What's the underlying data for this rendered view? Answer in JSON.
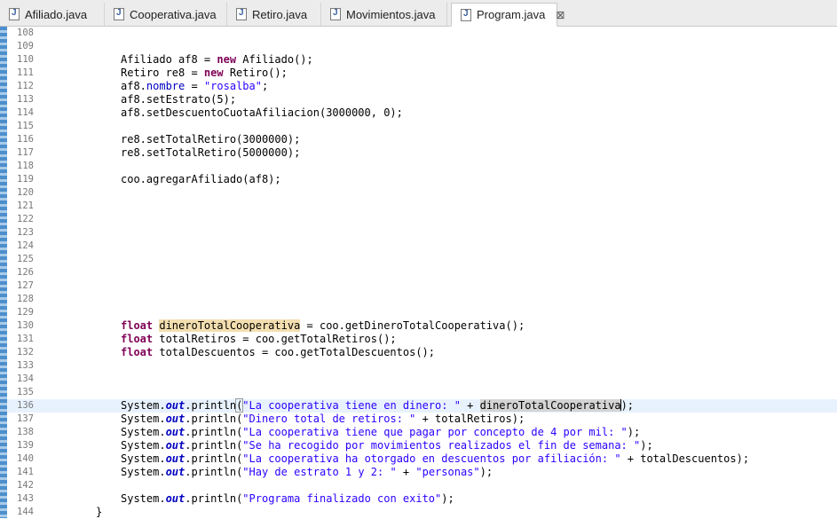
{
  "tabs": [
    {
      "label": "Afiliado.java"
    },
    {
      "label": "Cooperativa.java"
    },
    {
      "label": "Retiro.java"
    },
    {
      "label": "Movimientos.java"
    },
    {
      "label": "Program.java",
      "close": "⊠"
    }
  ],
  "lines": [
    {
      "n": "108",
      "t": ""
    },
    {
      "n": "109",
      "t": ""
    },
    {
      "n": "110",
      "t": "Afiliado af8 = new Afiliado();"
    },
    {
      "n": "111",
      "t": "Retiro re8 = new Retiro();"
    },
    {
      "n": "112",
      "t": "af8.nombre = \"rosalba\";"
    },
    {
      "n": "113",
      "t": "af8.setEstrato(5);"
    },
    {
      "n": "114",
      "t": "af8.setDescuentoCuotaAfiliacion(3000000, 0);"
    },
    {
      "n": "115",
      "t": ""
    },
    {
      "n": "116",
      "t": "re8.setTotalRetiro(3000000);"
    },
    {
      "n": "117",
      "t": "re8.setTotalRetiro(5000000);"
    },
    {
      "n": "118",
      "t": ""
    },
    {
      "n": "119",
      "t": "coo.agregarAfiliado(af8);"
    },
    {
      "n": "120",
      "t": ""
    },
    {
      "n": "121",
      "t": ""
    },
    {
      "n": "122",
      "t": ""
    },
    {
      "n": "123",
      "t": ""
    },
    {
      "n": "124",
      "t": ""
    },
    {
      "n": "125",
      "t": ""
    },
    {
      "n": "126",
      "t": ""
    },
    {
      "n": "127",
      "t": ""
    },
    {
      "n": "128",
      "t": ""
    },
    {
      "n": "129",
      "t": ""
    },
    {
      "n": "130",
      "t": "float dineroTotalCooperativa = coo.getDineroTotalCooperativa();"
    },
    {
      "n": "131",
      "t": "float totalRetiros = coo.getTotalRetiros();"
    },
    {
      "n": "132",
      "t": "float totalDescuentos = coo.getTotalDescuentos();"
    },
    {
      "n": "133",
      "t": ""
    },
    {
      "n": "134",
      "t": ""
    },
    {
      "n": "135",
      "t": ""
    },
    {
      "n": "136",
      "t": "System.out.println(\"La cooperativa tiene en dinero: \" + dineroTotalCooperativa);"
    },
    {
      "n": "137",
      "t": "System.out.println(\"Dinero total de retiros: \" + totalRetiros);"
    },
    {
      "n": "138",
      "t": "System.out.println(\"La cooperativa tiene que pagar por concepto de 4 por mil: \");"
    },
    {
      "n": "139",
      "t": "System.out.println(\"Se ha recogido por movimientos realizados el fin de semana: \");"
    },
    {
      "n": "140",
      "t": "System.out.println(\"La cooperativa ha otorgado en descuentos por afiliación: \" + totalDescuentos);"
    },
    {
      "n": "141",
      "t": "System.out.println(\"Hay de estrato 1 y 2: \" + \"personas\");"
    },
    {
      "n": "142",
      "t": ""
    },
    {
      "n": "143",
      "t": "System.out.println(\"Programa finalizado con exito\");"
    },
    {
      "n": "144",
      "t": "}"
    }
  ]
}
